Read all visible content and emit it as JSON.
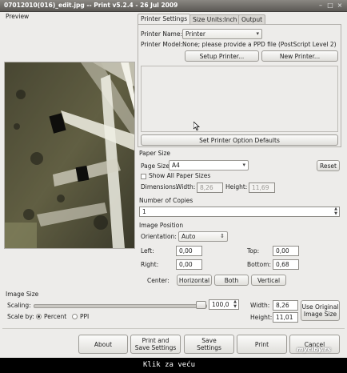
{
  "window": {
    "title": "07012010(016)_edit.jpg -- Print v5.2.4 - 26 Jul 2009",
    "close_glyph": "×",
    "minimize_glyph": "–",
    "maximize_glyph": "□"
  },
  "preview": {
    "label": "Preview"
  },
  "tabs": [
    "Printer Settings",
    "Size Units:Inch",
    "Output"
  ],
  "printer": {
    "name_label": "Printer Name:",
    "name_value": "Printer",
    "model_label": "Printer Model:",
    "model_value": "None; please provide a PPD file (PostScript Level 2)",
    "setup_button": "Setup Printer...",
    "new_button": "New Printer...",
    "defaults_button": "Set Printer Option Defaults"
  },
  "paper": {
    "section": "Paper Size",
    "page_size_label": "Page Size:",
    "page_size_value": "A4",
    "reset_button": "Reset",
    "show_all_label": "Show All Paper Sizes",
    "dimensions_label": "Dimensions:",
    "width_label": "Width:",
    "width_value": "8,26",
    "height_label": "Height:",
    "height_value": "11,69"
  },
  "copies": {
    "section": "Number of Copies",
    "value": "1"
  },
  "position": {
    "section": "Image Position",
    "orientation_label": "Orientation:",
    "orientation_value": "Auto",
    "left_label": "Left:",
    "left_value": "0,00",
    "top_label": "Top:",
    "top_value": "0,00",
    "right_label": "Right:",
    "right_value": "0,00",
    "bottom_label": "Bottom:",
    "bottom_value": "0,68",
    "center_label": "Center:",
    "horizontal_button": "Horizontal",
    "both_button": "Both",
    "vertical_button": "Vertical"
  },
  "image_size": {
    "section": "Image Size",
    "scaling_label": "Scaling:",
    "scaling_value": "100,0",
    "scaling_fraction": 1.0,
    "scale_by_label": "Scale by:",
    "percent_label": "Percent",
    "ppi_label": "PPI",
    "width_label": "Width:",
    "width_value": "8,26",
    "height_label": "Height:",
    "height_value": "11,01",
    "use_original_button_line1": "Use Original",
    "use_original_button_line2": "Image Size"
  },
  "actions": {
    "about": "About",
    "print_save_line1": "Print and",
    "print_save_line2": "Save Settings",
    "save_line1": "Save",
    "save_line2": "Settings",
    "print": "Print",
    "cancel": "Cancel"
  },
  "statusbar": {
    "text": "Klik za veću"
  },
  "watermark": {
    "text": "myciby.rs"
  }
}
